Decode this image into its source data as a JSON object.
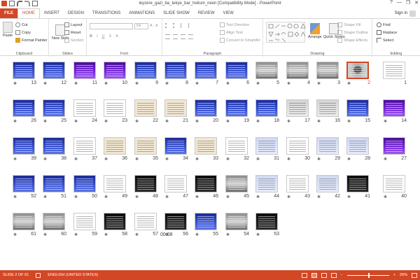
{
  "window": {
    "title": "leyzere_gazi_ba_tekye_bar_helium_neon [Compatibility Mode] - PowerPoint",
    "help_glyph": "?",
    "minimize_glyph": "—",
    "restore_glyph": "❐",
    "close_glyph": "✕"
  },
  "tabs": [
    "FILE",
    "HOME",
    "INSERT",
    "DESIGN",
    "TRANSITIONS",
    "ANIMATIONS",
    "SLIDE SHOW",
    "REVIEW",
    "VIEW"
  ],
  "active_tab": "HOME",
  "signin_label": "Sign in",
  "ribbon": {
    "clipboard": {
      "name": "Clipboard",
      "paste": "Paste",
      "cut": "Cut",
      "copy": "Copy",
      "format_painter": "Format Painter"
    },
    "slides": {
      "name": "Slides",
      "new_slide": "New Slide",
      "layout": "Layout",
      "reset": "Reset",
      "section": "Section"
    },
    "font": {
      "name": "Font",
      "size": "54"
    },
    "paragraph": {
      "name": "Paragraph",
      "text_direction": "Text Direction",
      "align_text": "Align Text",
      "convert_smartart": "Convert to SmartArt"
    },
    "drawing": {
      "name": "Drawing",
      "arrange": "Arrange",
      "quick_styles": "Quick Styles",
      "shape_fill": "Shape Fill",
      "shape_outline": "Shape Outline",
      "shape_effects": "Shape Effects"
    },
    "editing": {
      "name": "Editing",
      "find": "Find",
      "replace": "Replace",
      "select": "Select"
    }
  },
  "star_glyph": "✱",
  "slides": [
    {
      "n": "13",
      "style": "blue"
    },
    {
      "n": "12",
      "style": "blue"
    },
    {
      "n": "11",
      "style": "purple"
    },
    {
      "n": "10",
      "style": "purple"
    },
    {
      "n": "9",
      "style": "blue"
    },
    {
      "n": "8",
      "style": "blue"
    },
    {
      "n": "7",
      "style": "blue"
    },
    {
      "n": "6",
      "style": "blue"
    },
    {
      "n": "5",
      "style": "photo"
    },
    {
      "n": "4",
      "style": "photo"
    },
    {
      "n": "3",
      "style": "photo"
    },
    {
      "n": "2",
      "style": "portrait"
    },
    {
      "n": "1",
      "style": "white"
    },
    {
      "n": "26",
      "style": "blue"
    },
    {
      "n": "25",
      "style": "blue"
    },
    {
      "n": "24",
      "style": "diagram"
    },
    {
      "n": "23",
      "style": "diagram"
    },
    {
      "n": "22",
      "style": "beige"
    },
    {
      "n": "21",
      "style": "beige"
    },
    {
      "n": "20",
      "style": "blue"
    },
    {
      "n": "19",
      "style": "blue"
    },
    {
      "n": "18",
      "style": "blue"
    },
    {
      "n": "17",
      "style": "gray"
    },
    {
      "n": "16",
      "style": "gray"
    },
    {
      "n": "15",
      "style": "blue"
    },
    {
      "n": "14",
      "style": "purple"
    },
    {
      "n": "39",
      "style": "blue"
    },
    {
      "n": "38",
      "style": "blue"
    },
    {
      "n": "37",
      "style": "diagram"
    },
    {
      "n": "36",
      "style": "beige"
    },
    {
      "n": "35",
      "style": "beige"
    },
    {
      "n": "34",
      "style": "blue"
    },
    {
      "n": "33",
      "style": "beige"
    },
    {
      "n": "32",
      "style": "white"
    },
    {
      "n": "31",
      "style": "lightblue"
    },
    {
      "n": "30",
      "style": "diagram"
    },
    {
      "n": "29",
      "style": "lightblue"
    },
    {
      "n": "28",
      "style": "lightblue"
    },
    {
      "n": "27",
      "style": "purple"
    },
    {
      "n": "52",
      "style": "blue"
    },
    {
      "n": "51",
      "style": "blue"
    },
    {
      "n": "50",
      "style": "blue"
    },
    {
      "n": "49",
      "style": "diagram"
    },
    {
      "n": "48",
      "style": "dark"
    },
    {
      "n": "47",
      "style": "diagram"
    },
    {
      "n": "46",
      "style": "dark"
    },
    {
      "n": "45",
      "style": "photo"
    },
    {
      "n": "44",
      "style": "lightblue"
    },
    {
      "n": "43",
      "style": "diagram"
    },
    {
      "n": "42",
      "style": "lightblue"
    },
    {
      "n": "41",
      "style": "dark"
    },
    {
      "n": "40",
      "style": "diagram"
    },
    {
      "n": "61",
      "style": "photo"
    },
    {
      "n": "60",
      "style": "photo"
    },
    {
      "n": "59",
      "style": "diagram"
    },
    {
      "n": "58",
      "style": "dark"
    },
    {
      "n": "57",
      "style": "white"
    },
    {
      "n": "56",
      "style": "dark",
      "timing": "00:08"
    },
    {
      "n": "55",
      "style": "blue"
    },
    {
      "n": "54",
      "style": "photo"
    },
    {
      "n": "53",
      "style": "dark"
    }
  ],
  "selected_slide": "2",
  "status": {
    "slide_info": "SLIDE 2 OF 61",
    "language": "ENGLISH (UNITED STATES)",
    "zoom": "26%",
    "zoom_level": 0.5,
    "minus": "−",
    "plus": "+"
  },
  "colors": {
    "accent": "#d24726"
  }
}
